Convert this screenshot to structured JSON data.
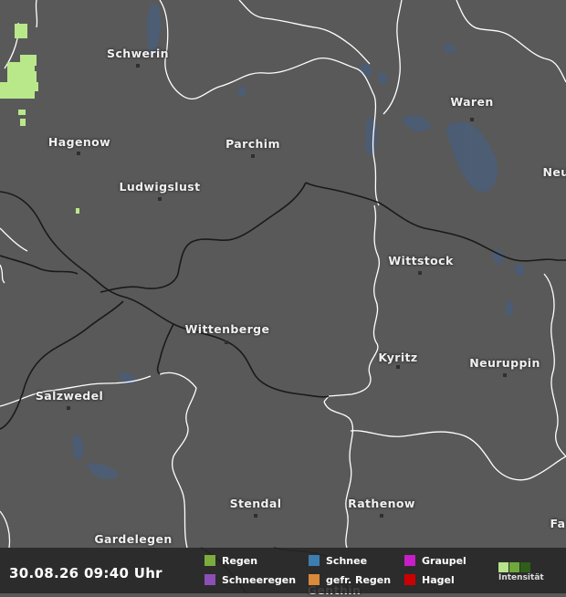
{
  "map": {
    "cities": [
      {
        "name": "Schwerin"
      },
      {
        "name": "Waren"
      },
      {
        "name": "Hagenow"
      },
      {
        "name": "Parchim"
      },
      {
        "name": "Neu"
      },
      {
        "name": "Ludwigslust"
      },
      {
        "name": "Wittstock"
      },
      {
        "name": "Wittenberge"
      },
      {
        "name": "Kyritz"
      },
      {
        "name": "Neuruppin"
      },
      {
        "name": "Salzwedel"
      },
      {
        "name": "Stendal"
      },
      {
        "name": "Rathenow"
      },
      {
        "name": "Fa"
      },
      {
        "name": "Gardelegen"
      },
      {
        "name": "Genthin"
      }
    ],
    "colors": {
      "background": "#595959",
      "water": "#4b5d75",
      "border": "#ffffff",
      "river": "#1a1a1a",
      "precip": "#b9e88a"
    }
  },
  "legend": {
    "timestamp": "30.08.26 09:40 Uhr",
    "items": [
      {
        "label": "Regen",
        "color": "#7cab3e"
      },
      {
        "label": "Schneeregen",
        "color": "#8b4fb6"
      },
      {
        "label": "Schnee",
        "color": "#3d7db0"
      },
      {
        "label": "gefr. Regen",
        "color": "#d98a3a"
      },
      {
        "label": "Graupel",
        "color": "#c71ec7"
      },
      {
        "label": "Hagel",
        "color": "#cc0000"
      }
    ],
    "intensity_label": "Intensität",
    "intensity_colors": [
      "#b5e48c",
      "#6fa83a",
      "#2f5e1a"
    ]
  }
}
